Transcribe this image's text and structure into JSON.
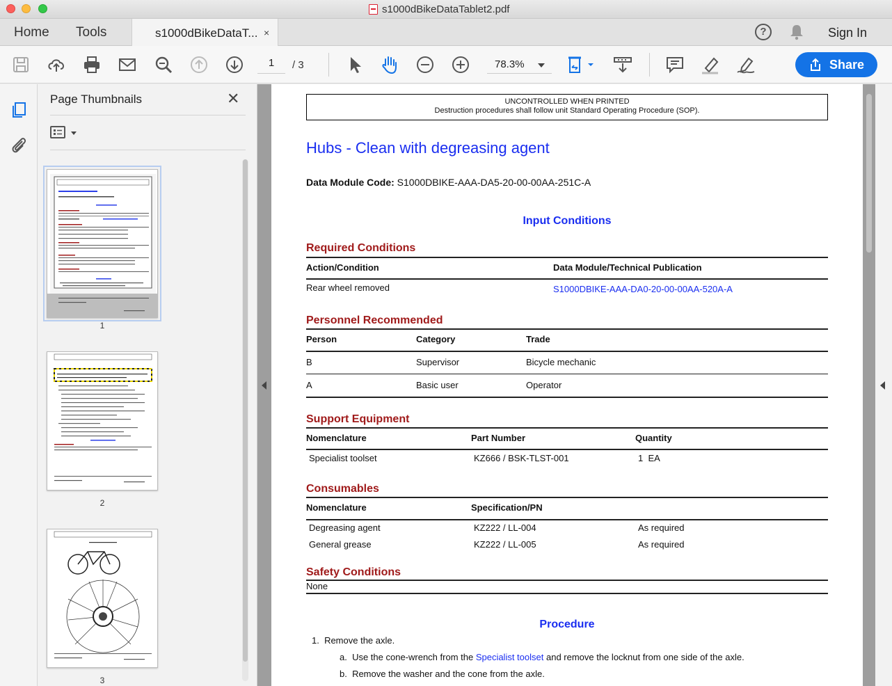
{
  "window": {
    "title": "s1000dBikeDataTablet2.pdf"
  },
  "tabs": {
    "home": "Home",
    "tools": "Tools",
    "document": "s1000dBikeDataT...",
    "close": "×"
  },
  "header": {
    "help": "?",
    "signin": "Sign In"
  },
  "toolbar": {
    "page_current": "1",
    "page_total": "/ 3",
    "zoom": "78.3%",
    "share": "Share"
  },
  "thumbnails": {
    "title": "Page Thumbnails",
    "close": "✕",
    "pages": [
      {
        "label": "1"
      },
      {
        "label": "2"
      },
      {
        "label": "3"
      }
    ]
  },
  "document": {
    "banner_line1": "UNCONTROLLED WHEN PRINTED",
    "banner_line2": "Destruction procedures shall follow unit Standard Operating Procedure (SOP).",
    "title": "Hubs - Clean with degreasing agent",
    "dmc_label": "Data Module Code:",
    "dmc_value": "S1000DBIKE-AAA-DA5-20-00-00AA-251C-A",
    "input_conditions": "Input Conditions",
    "required_conditions": {
      "heading": "Required Conditions",
      "col1": "Action/Condition",
      "col2": "Data Module/Technical Publication",
      "row_action": "Rear wheel removed",
      "row_ref": "S1000DBIKE-AAA-DA0-20-00-00AA-520A-A"
    },
    "personnel": {
      "heading": "Personnel Recommended",
      "col1": "Person",
      "col2": "Category",
      "col3": "Trade",
      "rows": [
        {
          "person": "B",
          "category": "Supervisor",
          "trade": "Bicycle mechanic"
        },
        {
          "person": "A",
          "category": "Basic user",
          "trade": "Operator"
        }
      ]
    },
    "support_equipment": {
      "heading": "Support Equipment",
      "col1": "Nomenclature",
      "col2": "Part Number",
      "col3": "Quantity",
      "row_name": "Specialist toolset",
      "row_pn": "KZ666 / BSK-TLST-001",
      "row_qty": "1  EA"
    },
    "consumables": {
      "heading": "Consumables",
      "col1": "Nomenclature",
      "col2": "Specification/PN",
      "rows": [
        {
          "name": "Degreasing agent",
          "spec": "KZ222 / LL-004",
          "qty": "As required"
        },
        {
          "name": "General grease",
          "spec": "KZ222 / LL-005",
          "qty": "As required"
        }
      ]
    },
    "safety": {
      "heading": "Safety Conditions",
      "value": "None"
    },
    "procedure": {
      "heading": "Procedure",
      "step1": "1.  Remove the axle.",
      "step1a_pre": "a.  Use the cone-wrench from the ",
      "step1a_link": "Specialist toolset",
      "step1a_post": " and remove the locknut from one side of the axle.",
      "step1b": "b.  Remove the washer and the cone from the axle."
    }
  }
}
